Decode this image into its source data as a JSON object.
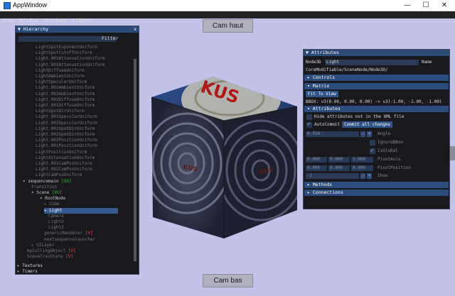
{
  "window": {
    "title": "AppWindow",
    "controls": [
      "—",
      "☐",
      "✕"
    ]
  },
  "menu": [
    "Draw",
    "Window",
    "Settings",
    "Widgets"
  ],
  "cam_buttons": {
    "top": "Cam haut",
    "bottom": "Cam bas"
  },
  "cube_logo": "KUS",
  "hierarchy": {
    "title": "Hierarchy",
    "filter_label": "Filter",
    "close": "x",
    "items": [
      {
        "label": "LightSpotExponentUniform",
        "indent": 4
      },
      {
        "label": "LightSpotCutoffUniform",
        "indent": 4
      },
      {
        "label": "Light.001AttenuationUniform",
        "indent": 4
      },
      {
        "label": "Light.002AttenuationUniform",
        "indent": 4
      },
      {
        "label": "LightDiffuseUniform",
        "indent": 4
      },
      {
        "label": "LightAmbientUniform",
        "indent": 4
      },
      {
        "label": "LightSpecularUniform",
        "indent": 4
      },
      {
        "label": "Light.001AmbientUniform",
        "indent": 4
      },
      {
        "label": "Light.002AmbientUniform",
        "indent": 4
      },
      {
        "label": "Light.002DiffuseUniform",
        "indent": 4
      },
      {
        "label": "Light.001DiffuseUniform",
        "indent": 4
      },
      {
        "label": "LightSpotDirUniform",
        "indent": 4
      },
      {
        "label": "Light.001SpecularUniform",
        "indent": 4
      },
      {
        "label": "Light.002SpecularUniform",
        "indent": 4
      },
      {
        "label": "Light.001SpotDirUniform",
        "indent": 4
      },
      {
        "label": "Light.002SpotDirUniform",
        "indent": 4
      },
      {
        "label": "Light.002PositionUniform",
        "indent": 4
      },
      {
        "label": "Light.001PositionUniform",
        "indent": 4
      },
      {
        "label": "LightPositionUniform",
        "indent": 4
      },
      {
        "label": "LightAttenuationUniform",
        "indent": 4
      },
      {
        "label": "Light.001CamPosUniform",
        "indent": 4
      },
      {
        "label": "Light.002CamPosUniform",
        "indent": 4
      },
      {
        "label": "LightCamPosUniform",
        "indent": 4
      },
      {
        "label": "▾ sequencemain",
        "tag": "[VG]",
        "tag_color": "green",
        "indent": 1,
        "on": true
      },
      {
        "label": "transition",
        "indent": 3
      },
      {
        "label": "▾ Scene",
        "tag": "[VG]",
        "tag_color": "green",
        "indent": 3,
        "on": true
      },
      {
        "label": "▾ RootNode",
        "indent": 5,
        "on": true
      },
      {
        "label": "▸ Cube",
        "indent": 6
      },
      {
        "label": "▸ Light",
        "indent": 6,
        "on": true,
        "selected": true
      },
      {
        "label": "Camera",
        "indent": 7
      },
      {
        "label": "Light2",
        "indent": 7
      },
      {
        "label": "Light3",
        "indent": 7
      },
      {
        "label": "genericRenderer",
        "tag": "[V]",
        "tag_color": "red",
        "indent": 6
      },
      {
        "label": "nextsequencelauncher",
        "indent": 6
      },
      {
        "label": "▸ UILayer",
        "indent": 3
      },
      {
        "label": "myCullingObject",
        "tag": "[V]",
        "tag_color": "red",
        "indent": 2
      },
      {
        "label": "SceneTravState",
        "tag": "[V]",
        "tag_color": "red",
        "indent": 2
      }
    ],
    "footer": [
      "▸ Textures",
      "▸ Timers"
    ]
  },
  "attributes": {
    "title": "Attributes",
    "node_type": "Node3D",
    "node_name": "Light",
    "name_label": "Name",
    "path": "CoreModifiable/SceneNode/Node3D/",
    "sections": {
      "controls": "Controls",
      "matrix": "Matrix",
      "attributes": "Attributes",
      "methods": "Methods",
      "connections": "Connections"
    },
    "fit_to_view": "Fit To View",
    "bbox": "BBOX: v3(0.00, 0.00, 0.00) -> v3(-1.00, -1.00, -1.00)",
    "hide_not_in_xml": "Hide attributes not in the XML file",
    "autocommit": "AutoCommit",
    "commit_all": "Commit all changes",
    "angle_value": "0.954",
    "angle_label": "Angle",
    "ignore_bbox": "IgnoreBBox",
    "is_global": "IsGlobal",
    "pivot_axis": [
      "0.000",
      "0.000",
      "1.000"
    ],
    "pivot_axis_label": "PivotAxis",
    "pivot_position": [
      "0.000",
      "0.000",
      "0.000"
    ],
    "pivot_position_label": "PivotPosition",
    "show_value": "-1",
    "show_label": "Show",
    "spin_minus": "-",
    "spin_plus": "+"
  }
}
